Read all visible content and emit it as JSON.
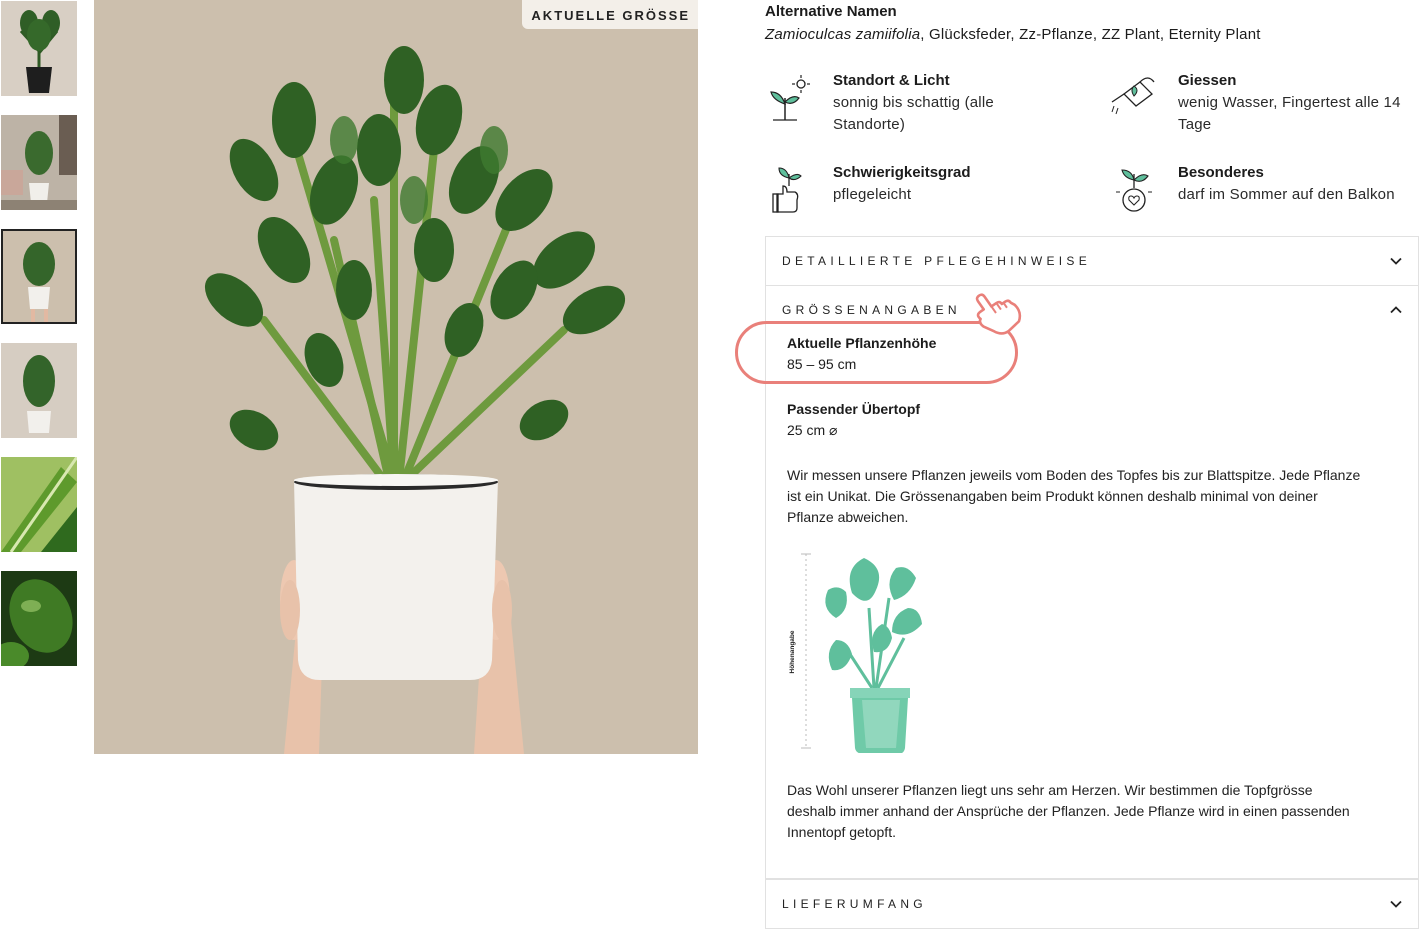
{
  "gallery": {
    "thumbnails": [
      {
        "alt": "ZZ plant in black pot"
      },
      {
        "alt": "ZZ plant in living room"
      },
      {
        "alt": "ZZ plant held in white pot"
      },
      {
        "alt": "ZZ plant in white pot"
      },
      {
        "alt": "Leaf close-up"
      },
      {
        "alt": "Leaf detail"
      }
    ],
    "active_index": 2,
    "badge": "AKTUELLE GRÖSSE"
  },
  "alt_names": {
    "title": "Alternative Namen",
    "latin": "Zamioculcas zamiifolia",
    "others": ", Glücksfeder, Zz-Pflanze, ZZ Plant, Eternity Plant"
  },
  "care": [
    {
      "icon": "sun-seedling-icon",
      "title": "Standort & Licht",
      "desc1": "sonnig bis schattig (alle",
      "desc2": "Standorte)"
    },
    {
      "icon": "watering-can-icon",
      "title": "Giessen",
      "desc1": "wenig Wasser, Fingertest alle 14",
      "desc2": "Tage"
    },
    {
      "icon": "thumbs-up-seedling-icon",
      "title": "Schwierigkeitsgrad",
      "desc1": "pflegeleicht",
      "desc2": ""
    },
    {
      "icon": "heart-seedling-icon",
      "title": "Besonderes",
      "desc1": "darf im Sommer auf den Balkon",
      "desc2": ""
    }
  ],
  "accordion": {
    "care_details": "DETAILLIERTE PFLEGEHINWEISE",
    "sizes": "GRÖSSENANGABEN",
    "delivery": "LIEFERUMFANG"
  },
  "sizes": {
    "height_label": "Aktuelle Pflanzenhöhe",
    "height_value": "85 – 95 cm",
    "pot_label": "Passender Übertopf",
    "pot_value": "25 cm ⌀",
    "measure_p1": "Wir messen unsere Pflanzen jeweils vom Boden des Topfes bis zur Blattspitze. Jede Pflanze",
    "measure_p2": "ist ein Unikat. Die Grössenangaben beim Produkt können deshalb minimal von deiner",
    "measure_p3": "Pflanze abweichen.",
    "diagram_label": "Höhenangabe",
    "pot_p1": "Das Wohl unserer Pflanzen liegt uns sehr am Herzen. Wir bestimmen die Topfgrösse",
    "pot_p2": "deshalb immer anhand der Ansprüche der Pflanzen. Jede Pflanze wird in einen passenden",
    "pot_p3": "Innentopf getopft."
  },
  "colors": {
    "highlight": "#e9807a",
    "mint": "#5fbf9c",
    "background_photo": "#ccbfad"
  }
}
